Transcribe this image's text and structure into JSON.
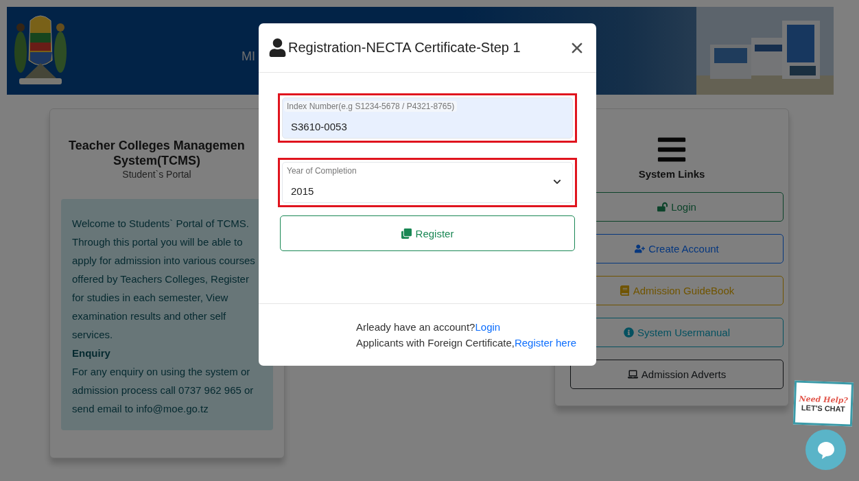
{
  "header": {
    "title_fragment": "MI"
  },
  "intro_card": {
    "title_lines": [
      "Teacher Colleges Managemen",
      "System(TCMS)"
    ],
    "subtitle": "Student`s Portal",
    "welcome": "Welcome to Students` Portal of TCMS. Through this portal you will be able to apply for admission into various courses offered by Teachers Colleges, Register for studies in each semester, View examination results and other self services.",
    "enquiry_heading": "Enquiry",
    "enquiry_text": "For any enquiry on using the system or admission process call 0737 962 965 or send email to info@moe.go.tz"
  },
  "links_card": {
    "title": "System Links",
    "links": [
      {
        "label": "Login",
        "kind": "success"
      },
      {
        "label": "Create Account",
        "kind": "primary"
      },
      {
        "label": "Admission GuideBook",
        "kind": "warning"
      },
      {
        "label": "System Usermanual",
        "kind": "info"
      },
      {
        "label": "Admission Adverts",
        "kind": "dark"
      }
    ]
  },
  "modal": {
    "title": "Registration-NECTA Certificate-Step 1",
    "fields": [
      {
        "kind": "text",
        "label": "Index Number(e.g S1234-5678 / P4321-8765)",
        "value": "S3610-0053",
        "highlighted": true
      },
      {
        "kind": "select",
        "label": "Year of Completion",
        "value": "2015",
        "highlighted": true
      }
    ],
    "submit": "Register",
    "footer": [
      {
        "text": "Arleady have an account?",
        "link": "Login"
      },
      {
        "text": "Applicants with Foreign Certificate,",
        "link": "Register here"
      }
    ]
  },
  "chat": {
    "badge_lines": [
      "Need Help?",
      "LET'S CHAT"
    ]
  }
}
